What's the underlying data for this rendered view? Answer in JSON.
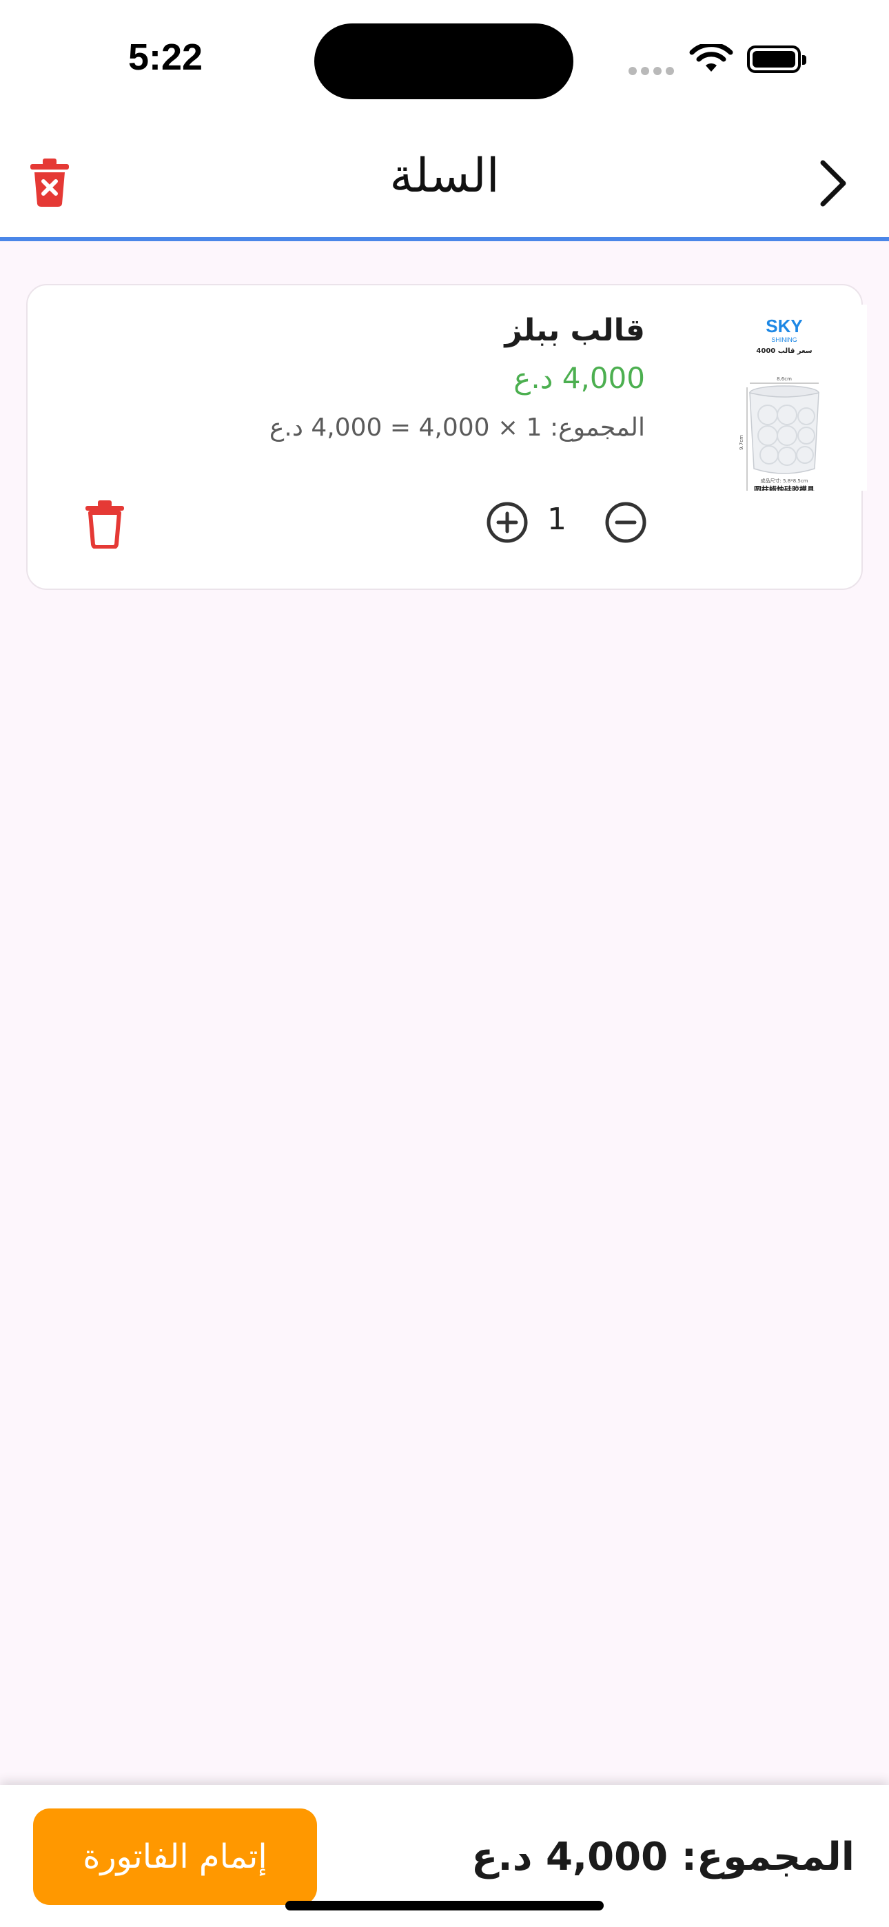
{
  "status_bar": {
    "time": "5:22"
  },
  "app_bar": {
    "title": "السلة"
  },
  "cart_item": {
    "name": "قالب ببلز",
    "price": "4,000 د.ع",
    "subtotal": "المجموع: 1 × 4,000 = 4,000 د.ع",
    "quantity": "1",
    "image_brand": "SKY",
    "image_brand_sub": "SHINING",
    "image_caption_top": "سعر قالب 4000",
    "image_dimension_top": "8.6cm",
    "image_dimension_side": "9.7cm",
    "image_caption_size": "成品尺寸: 5.8*8.5cm",
    "image_caption_bottom": "圆柱蜡烛硅胶模具"
  },
  "bottom_bar": {
    "total": "المجموع: 4,000 د.ع",
    "checkout_label": "إتمام الفاتورة"
  },
  "colors": {
    "accent_line": "#4a86e8",
    "delete_red": "#e53935",
    "price_green": "#4caf50",
    "checkout_orange": "#ff9800"
  }
}
